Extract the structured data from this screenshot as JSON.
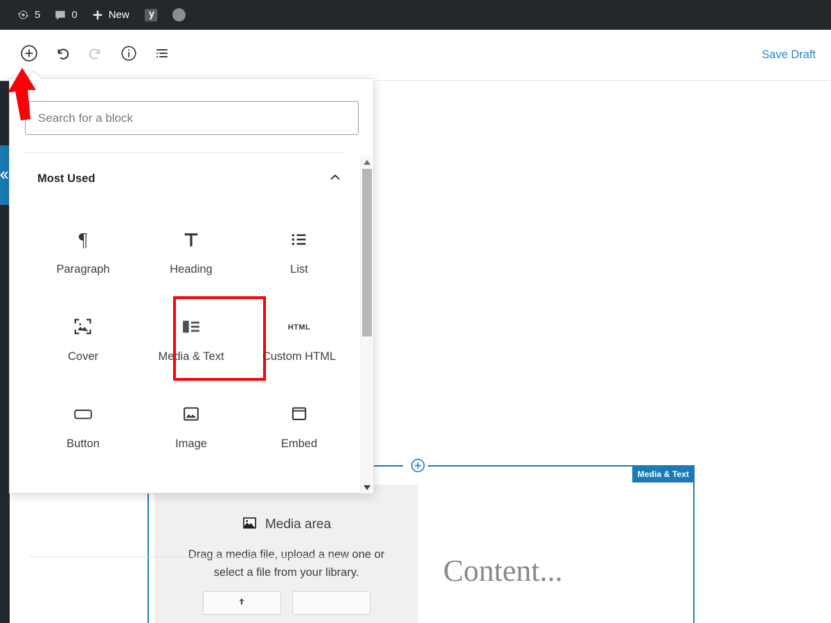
{
  "adminbar": {
    "updates_icon": "updates-icon",
    "updates_count": "5",
    "comments_icon": "comment-icon",
    "comments_count": "0",
    "new_icon": "plus-icon",
    "new_label": "New",
    "yoast_icon": "yoast-logo-icon",
    "avatar": "user-avatar"
  },
  "topbar": {
    "add_block_icon": "plus-circle-icon",
    "undo_icon": "undo-icon",
    "redo_icon": "redo-icon",
    "info_icon": "info-circle-icon",
    "list_view_icon": "list-view-icon",
    "save_draft_label": "Save Draft"
  },
  "sidebar_tab": {
    "icon": "chevron-left-double-icon"
  },
  "inserter": {
    "search": {
      "placeholder": "Search for a block",
      "value": ""
    },
    "panel": {
      "title": "Most Used",
      "collapse_icon": "chevron-up-icon"
    },
    "blocks": [
      {
        "label": "Paragraph",
        "icon": "paragraph-icon",
        "highlighted": false
      },
      {
        "label": "Heading",
        "icon": "heading-icon",
        "highlighted": false
      },
      {
        "label": "List",
        "icon": "list-icon",
        "highlighted": false
      },
      {
        "label": "Cover",
        "icon": "cover-icon",
        "highlighted": false
      },
      {
        "label": "Media & Text",
        "icon": "media-text-icon",
        "highlighted": true
      },
      {
        "label": "Custom HTML",
        "icon": "html-icon",
        "highlighted": false
      },
      {
        "label": "Button",
        "icon": "button-icon",
        "highlighted": false
      },
      {
        "label": "Image",
        "icon": "image-icon",
        "highlighted": false
      },
      {
        "label": "Embed",
        "icon": "embed-icon",
        "highlighted": false
      }
    ],
    "scrollbar": {
      "up_icon": "scroll-up-arrow-icon",
      "down_icon": "scroll-down-arrow-icon"
    }
  },
  "canvas": {
    "block_inserter_icon": "plus-circle-icon",
    "selected_block": {
      "badge_label": "Media & Text",
      "content_text": "Content..."
    },
    "media_area": {
      "icon": "image-placeholder-icon",
      "title": "Media area",
      "description": "Drag a media file, upload a new one or select a file from your library.",
      "upload_icon": "upload-icon",
      "library_label": ""
    }
  },
  "annotation": {
    "arrow": "red-arrow-up",
    "color": "#fb0007"
  },
  "colors": {
    "adminbar_bg": "#23282d",
    "accent_blue": "#1b7cb5",
    "link_blue": "#2986c4",
    "highlight_red": "#fb0007",
    "media_area_bg": "#f0f0f0"
  }
}
